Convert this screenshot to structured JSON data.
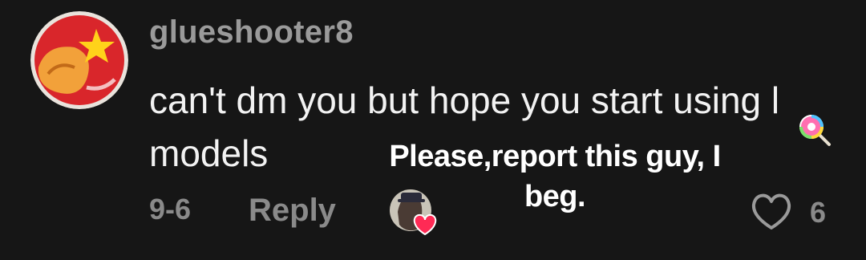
{
  "comment": {
    "username": "glueshooter8",
    "text_line1": "can't dm you but hope you start using l",
    "text_line2": "models",
    "date": "9-6",
    "reply_label": "Reply",
    "like_count": "6",
    "avatar_icon": "red-star-character-avatar",
    "creator_liked_icon": "creator-avatar-heart-icon",
    "lollipop_icon": "lollipop-emoji-icon"
  },
  "overlay": {
    "line1": "Please,report this guy, I",
    "line2": "beg."
  },
  "colors": {
    "background": "#161616",
    "username": "#9a9a9a",
    "text": "#f2f2f2",
    "meta": "#8a8a8a",
    "heart": "#ff2a55"
  }
}
